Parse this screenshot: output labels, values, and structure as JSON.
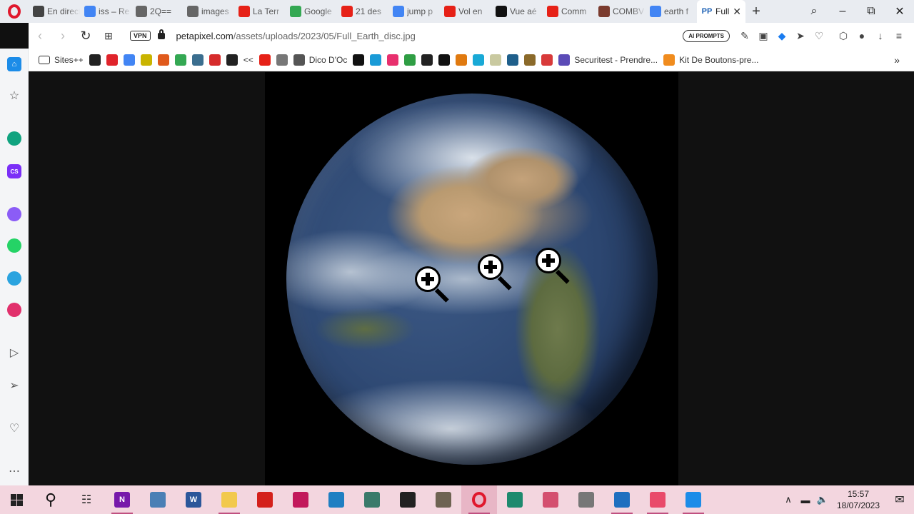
{
  "browser": {
    "tabs": [
      {
        "title": "En direct",
        "icon": "earth-live-icon",
        "color": "#444444"
      },
      {
        "title": "iss – Re",
        "icon": "google-icon",
        "color": "#4285f4"
      },
      {
        "title": "2Q== ",
        "icon": "globe-icon",
        "color": "#666666"
      },
      {
        "title": "images",
        "icon": "globe-icon",
        "color": "#666666"
      },
      {
        "title": "La Terr",
        "icon": "youtube-icon",
        "color": "#e62117"
      },
      {
        "title": "Google",
        "icon": "maps-icon",
        "color": "#34a853"
      },
      {
        "title": "21 des",
        "icon": "youtube-icon",
        "color": "#e62117"
      },
      {
        "title": "jump p",
        "icon": "google-icon",
        "color": "#4285f4"
      },
      {
        "title": "Vol en",
        "icon": "youtube-icon",
        "color": "#e62117"
      },
      {
        "title": "Vue aé",
        "icon": "tiktok-icon",
        "color": "#111111"
      },
      {
        "title": "Comm",
        "icon": "youtube-icon",
        "color": "#e62117"
      },
      {
        "title": "COMBV",
        "icon": "site-icon",
        "color": "#7a3b2e"
      },
      {
        "title": "earth f",
        "icon": "google-icon",
        "color": "#4285f4"
      }
    ],
    "active_tab": {
      "title": "Full",
      "icon": "petapixel-icon",
      "close": "✕"
    },
    "new_tab": "+",
    "url_domain": "petapixel.com",
    "url_path": "/assets/uploads/2023/05/Full_Earth_disc.jpg",
    "vpn_label": "VPN",
    "ai_prompts_label": "AI PROMPTS",
    "bookmarks": [
      {
        "label": "Sites++",
        "icon": "folder-icon",
        "color": "#ffffff"
      },
      {
        "label": "",
        "icon": "search-bookmark-icon",
        "color": "#222222"
      },
      {
        "label": "",
        "icon": "yandex-icon",
        "color": "#e0242b"
      },
      {
        "label": "",
        "icon": "google-icon",
        "color": "#4285f4"
      },
      {
        "label": "",
        "icon": "app-icon",
        "color": "#c9b400"
      },
      {
        "label": "",
        "icon": "app-icon",
        "color": "#e05a1c"
      },
      {
        "label": "",
        "icon": "maps-icon",
        "color": "#34a853"
      },
      {
        "label": "",
        "icon": "app-icon",
        "color": "#3b6e8f"
      },
      {
        "label": "",
        "icon": "app-icon",
        "color": "#d62b2b"
      },
      {
        "label": "",
        "icon": "amazon-icon",
        "color": "#222222"
      },
      {
        "label": "<<",
        "icon": "",
        "color": ""
      },
      {
        "label": "",
        "icon": "youtube-icon",
        "color": "#e62117"
      },
      {
        "label": "",
        "icon": "wiki-icon",
        "color": "#777777"
      },
      {
        "label": "Dico D'Oc",
        "icon": "document-icon",
        "color": "#555555"
      },
      {
        "label": "",
        "icon": "app-icon",
        "color": "#111111"
      },
      {
        "label": "",
        "icon": "app-icon",
        "color": "#1a9bd7"
      },
      {
        "label": "",
        "icon": "app-icon",
        "color": "#e8306e"
      },
      {
        "label": "",
        "icon": "download-icon",
        "color": "#2f9e44"
      },
      {
        "label": "",
        "icon": "cloud-icon",
        "color": "#222222"
      },
      {
        "label": "",
        "icon": "app-icon",
        "color": "#111111"
      },
      {
        "label": "",
        "icon": "app-icon",
        "color": "#e07a10"
      },
      {
        "label": "",
        "icon": "app-icon",
        "color": "#19a9d6"
      },
      {
        "label": "",
        "icon": "app-icon",
        "color": "#c9c9a0"
      },
      {
        "label": "",
        "icon": "app-icon",
        "color": "#1f5f8b"
      },
      {
        "label": "",
        "icon": "app-icon",
        "color": "#8b6a2a"
      },
      {
        "label": "",
        "icon": "app-icon",
        "color": "#d83a3a"
      },
      {
        "label": "Securitest - Prendre...",
        "icon": "app-icon",
        "color": "#5b4bb7"
      },
      {
        "label": "Kit De Boutons-pre...",
        "icon": "app-icon",
        "color": "#f08c1e"
      }
    ],
    "bookmarks_more": "»"
  },
  "sidebar": [
    {
      "name": "home",
      "icon": "home-icon",
      "color": "#1c8ce8"
    },
    {
      "name": "favorites",
      "icon": "star-icon",
      "color": ""
    },
    {
      "name": "chatgpt",
      "icon": "chatgpt-icon",
      "color": "#10a37f"
    },
    {
      "name": "cs",
      "icon": "cs-icon",
      "color": "#7b2ff7",
      "label": "CS"
    },
    {
      "name": "messenger",
      "icon": "messenger-icon",
      "color": "#8b5cf6"
    },
    {
      "name": "whatsapp",
      "icon": "whatsapp-icon",
      "color": "#25d366"
    },
    {
      "name": "telegram",
      "icon": "telegram-icon",
      "color": "#2aa3df"
    },
    {
      "name": "instagram",
      "icon": "instagram-icon",
      "color": "#e1306c"
    },
    {
      "name": "player",
      "icon": "player-icon",
      "color": ""
    },
    {
      "name": "send",
      "icon": "send-icon",
      "color": ""
    },
    {
      "name": "pinboard",
      "icon": "heart-icon",
      "color": ""
    },
    {
      "name": "more",
      "icon": "more-icon",
      "color": ""
    }
  ],
  "content": {
    "image_name": "Full_Earth_disc",
    "zoom_cursors": 3
  },
  "taskbar": {
    "apps": [
      {
        "name": "onenote",
        "icon": "onenote-icon",
        "color": "#7719aa",
        "label": "N",
        "running": true
      },
      {
        "name": "calculator",
        "icon": "calculator-icon",
        "color": "#4a7fb5",
        "label": "",
        "running": false
      },
      {
        "name": "word",
        "icon": "word-icon",
        "color": "#2b579a",
        "label": "W",
        "running": false
      },
      {
        "name": "explorer",
        "icon": "folder-icon",
        "color": "#f2c94c",
        "label": "",
        "running": true
      },
      {
        "name": "acrobat",
        "icon": "pdf-icon",
        "color": "#d4201b",
        "label": "",
        "running": false
      },
      {
        "name": "audio",
        "icon": "headphones-icon",
        "color": "#c2185b",
        "label": "",
        "running": false
      },
      {
        "name": "browser",
        "icon": "globe-icon",
        "color": "#1f7fc2",
        "label": "",
        "running": false
      },
      {
        "name": "app",
        "icon": "app-icon",
        "color": "#3a7a6a",
        "label": "",
        "running": false
      },
      {
        "name": "sticky",
        "icon": "note-icon",
        "color": "#222222",
        "label": "",
        "running": false
      },
      {
        "name": "gimp",
        "icon": "gimp-icon",
        "color": "#6e6352",
        "label": "",
        "running": false
      },
      {
        "name": "opera",
        "icon": "opera-icon",
        "color": "#e0182d",
        "label": "",
        "running": true,
        "active": true
      },
      {
        "name": "camtasia",
        "icon": "camtasia-icon",
        "color": "#1e8a6e",
        "label": "",
        "running": false
      },
      {
        "name": "snipping",
        "icon": "snip-icon",
        "color": "#d44f6f",
        "label": "",
        "running": false
      },
      {
        "name": "mic",
        "icon": "microphone-icon",
        "color": "#777777",
        "label": "",
        "running": false
      },
      {
        "name": "store",
        "icon": "store-icon",
        "color": "#1f6fbf",
        "label": "",
        "running": true
      },
      {
        "name": "recorder",
        "icon": "camera-icon",
        "color": "#e94a6a",
        "label": "",
        "running": true
      },
      {
        "name": "photos",
        "icon": "photos-icon",
        "color": "#1c8ce8",
        "label": "",
        "running": true
      }
    ],
    "time": "15:57",
    "date": "18/07/2023"
  }
}
